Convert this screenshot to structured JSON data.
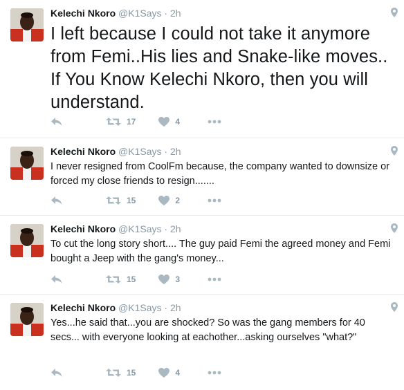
{
  "colors": {
    "icon": "#aab8c2",
    "meta": "#8899a6",
    "divider": "#e6ecf0",
    "jersey": "#c9301f"
  },
  "tweets": [
    {
      "name": "Kelechi Nkoro",
      "handle": "@K1Says",
      "separator": "·",
      "time": "2h",
      "text": "I left because I could not take it anymore from Femi..His lies and Snake-like moves.. If You Know Kelechi Nkoro, then you will understand.",
      "retweets": "17",
      "likes": "4"
    },
    {
      "name": "Kelechi Nkoro",
      "handle": "@K1Says",
      "separator": "·",
      "time": "2h",
      "text": "I never resigned from CoolFm because, the company wanted to downsize or forced my close friends to resign.......",
      "retweets": "15",
      "likes": "2"
    },
    {
      "name": "Kelechi Nkoro",
      "handle": "@K1Says",
      "separator": "·",
      "time": "2h",
      "text": "To cut the long story short.... The guy paid Femi the agreed money and Femi bought a Jeep with the gang's money...",
      "retweets": "15",
      "likes": "3"
    },
    {
      "name": "Kelechi Nkoro",
      "handle": "@K1Says",
      "separator": "·",
      "time": "2h",
      "text": "Yes...he said that...you are shocked?  So was the gang members for 40 secs... with everyone looking at eachother...asking ourselves \"what?\"",
      "retweets": "15",
      "likes": "4"
    }
  ]
}
